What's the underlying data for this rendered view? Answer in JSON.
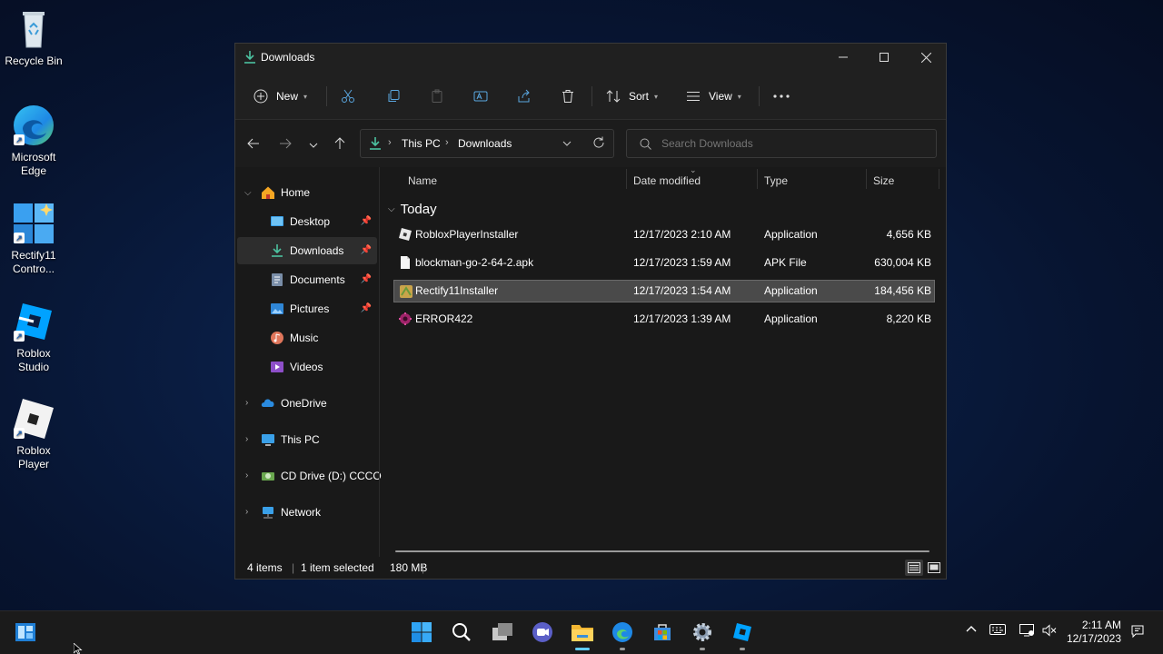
{
  "desktop": {
    "icons": [
      {
        "label": "Recycle Bin"
      },
      {
        "label": "Microsoft Edge"
      },
      {
        "label": "Rectify11 Contro..."
      },
      {
        "label": "Roblox Studio"
      },
      {
        "label": "Roblox Player"
      }
    ]
  },
  "window": {
    "title": "Downloads",
    "toolbar": {
      "new_label": "New",
      "sort_label": "Sort",
      "view_label": "View"
    },
    "breadcrumb": [
      "This PC",
      "Downloads"
    ],
    "search_placeholder": "Search Downloads",
    "sidebar": {
      "home": "Home",
      "items": [
        {
          "label": "Desktop",
          "pinned": true
        },
        {
          "label": "Downloads",
          "pinned": true,
          "active": true
        },
        {
          "label": "Documents",
          "pinned": true
        },
        {
          "label": "Pictures",
          "pinned": true
        },
        {
          "label": "Music",
          "pinned": false
        },
        {
          "label": "Videos",
          "pinned": false
        }
      ],
      "sections": [
        "OneDrive",
        "This PC",
        "CD Drive (D:) CCCO",
        "Network"
      ]
    },
    "columns": {
      "name": "Name",
      "date": "Date modified",
      "type": "Type",
      "size": "Size"
    },
    "group_label": "Today",
    "files": [
      {
        "name": "RobloxPlayerInstaller",
        "date": "12/17/2023 2:10 AM",
        "type": "Application",
        "size": "4,656 KB"
      },
      {
        "name": "blockman-go-2-64-2.apk",
        "date": "12/17/2023 1:59 AM",
        "type": "APK File",
        "size": "630,004 KB"
      },
      {
        "name": "Rectify11Installer",
        "date": "12/17/2023 1:54 AM",
        "type": "Application",
        "size": "184,456 KB",
        "selected": true
      },
      {
        "name": "ERROR422",
        "date": "12/17/2023 1:39 AM",
        "type": "Application",
        "size": "8,220 KB"
      }
    ],
    "status": {
      "items": "4 items",
      "selected": "1 item selected",
      "size": "180 MB"
    }
  },
  "taskbar": {
    "time": "2:11 AM",
    "date": "12/17/2023"
  },
  "colors": {
    "accent": "#60cdff",
    "window_bg": "#191919",
    "selection": "#4a4a4a"
  }
}
